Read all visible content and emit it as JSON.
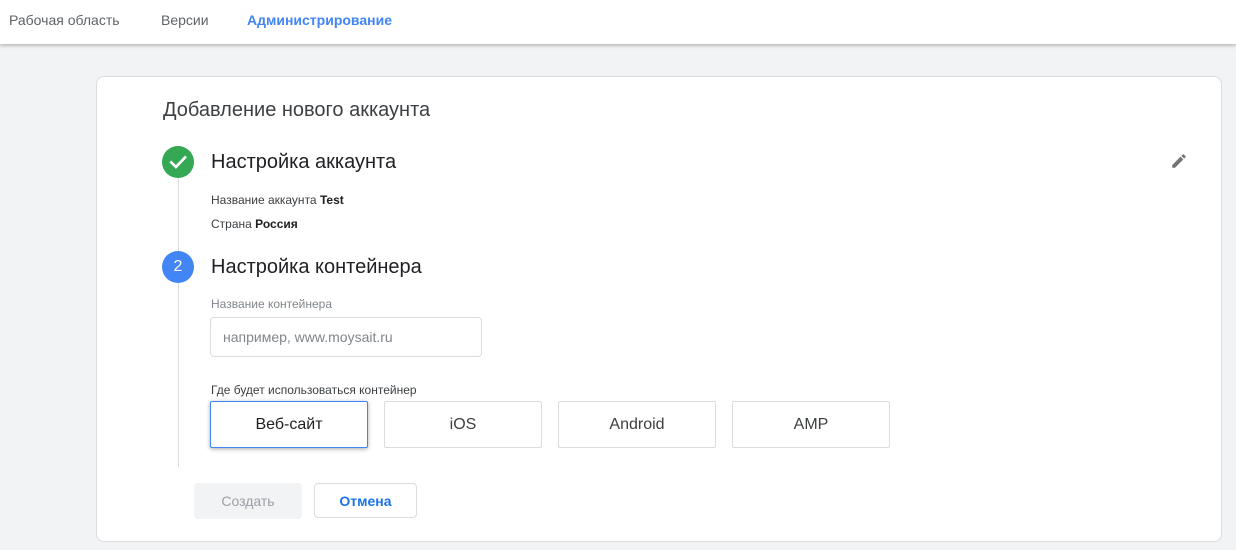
{
  "nav": {
    "tabs": [
      {
        "label": "Рабочая область",
        "active": false
      },
      {
        "label": "Версии",
        "active": false
      },
      {
        "label": "Администрирование",
        "active": true
      }
    ]
  },
  "page": {
    "title": "Добавление нового аккаунта"
  },
  "step1": {
    "title": "Настройка аккаунта",
    "status_icon": "check-icon",
    "edit_icon": "pencil-icon",
    "account_name_label": "Название аккаунта",
    "account_name_value": "Test",
    "country_label": "Страна",
    "country_value": "Россия"
  },
  "step2": {
    "number": "2",
    "title": "Настройка контейнера",
    "container_name_label": "Название контейнера",
    "container_name_placeholder": "например, www.moysait.ru",
    "container_name_value": "",
    "usage_label": "Где будет использоваться контейнер",
    "platforms": [
      {
        "label": "Веб-сайт",
        "selected": true
      },
      {
        "label": "iOS",
        "selected": false
      },
      {
        "label": "Android",
        "selected": false
      },
      {
        "label": "AMP",
        "selected": false
      }
    ]
  },
  "actions": {
    "create_label": "Создать",
    "cancel_label": "Отмена"
  },
  "colors": {
    "accent": "#4285f4",
    "success": "#34a853",
    "link": "#1a73e8"
  }
}
